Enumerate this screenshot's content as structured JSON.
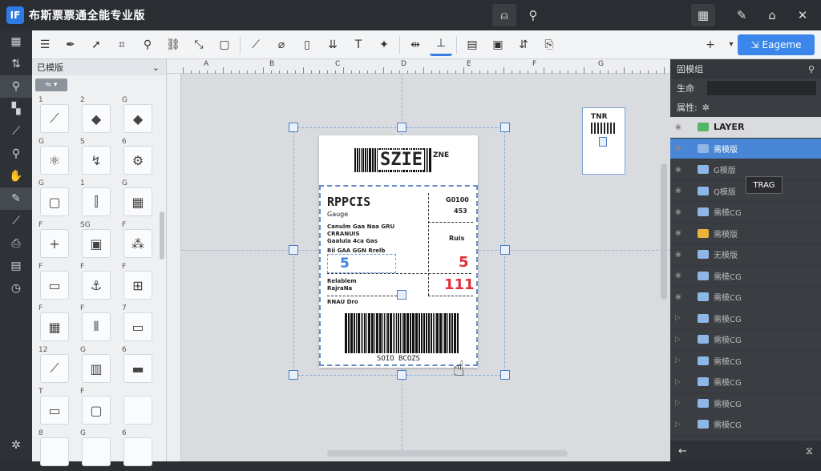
{
  "app": {
    "logo": "IF",
    "title": "布斯票票通全能专业版"
  },
  "titlebar_icons": [
    "bell-icon",
    "search-icon",
    "grid-icon",
    "pen-icon",
    "home-icon",
    "close-icon"
  ],
  "toolbar": {
    "export_label": "Eageme"
  },
  "palette": {
    "header": "已模版",
    "select_label": "⇋ ▾",
    "numbers": [
      "1",
      "2",
      "G",
      "G",
      "S",
      "6",
      "G",
      "1",
      "G",
      "F",
      "SG",
      "F",
      "F",
      "F",
      "F",
      "F",
      "F",
      "7",
      "12",
      "G",
      "6",
      "T",
      "F",
      "",
      "8",
      "G",
      "6"
    ]
  },
  "ruler": {
    "labels": [
      "A",
      "B",
      "C",
      "D",
      "E",
      "F",
      "G"
    ]
  },
  "label": {
    "brand_text": "RPPCIS",
    "subtitle": "Gauge",
    "line1": "Canulm  Gaa  Naa  GRU",
    "line2": "CRRANUIS",
    "line3": "Gaalula  4ca  Gas",
    "line4": "Rii  GAA  GGN  Rrelb",
    "left_num": "5",
    "right_code": "G0100",
    "right_code2": "453",
    "right_label": "Ruis",
    "right_num1": "5",
    "right_num2": "111",
    "b1": "Relablem",
    "b2": "RajraNa",
    "b3": "RNAU  Dro",
    "barcode_text": "SOIO  BCOZS",
    "top_text": "SZIE",
    "top_small": "ZNE"
  },
  "preview": {
    "text": "TNR"
  },
  "right": {
    "header": "固模组",
    "field_label": "生命",
    "prop_label": "属性:",
    "layers": [
      {
        "name": "LAYER",
        "type": "top"
      },
      {
        "name": "需模版",
        "type": "sel"
      },
      {
        "name": "G模版",
        "type": "normal"
      },
      {
        "name": "Q模版",
        "type": "normal"
      },
      {
        "name": "需模CG",
        "type": "normal"
      },
      {
        "name": "需模版",
        "type": "yellow"
      },
      {
        "name": "无模版",
        "type": "normal"
      },
      {
        "name": "需模CG",
        "type": "normal"
      },
      {
        "name": "需模CG",
        "type": "normal"
      },
      {
        "name": "需模CG",
        "type": "normal"
      },
      {
        "name": "需模CG",
        "type": "normal"
      },
      {
        "name": "需模CG",
        "type": "normal"
      },
      {
        "name": "需模CG",
        "type": "normal"
      },
      {
        "name": "需模CG",
        "type": "normal"
      },
      {
        "name": "需模CG",
        "type": "normal"
      }
    ],
    "tooltip": "TRAG"
  },
  "colors": {
    "accent": "#3a86ea",
    "selected_layer": "#4a86d6",
    "red": "#e0303a"
  }
}
